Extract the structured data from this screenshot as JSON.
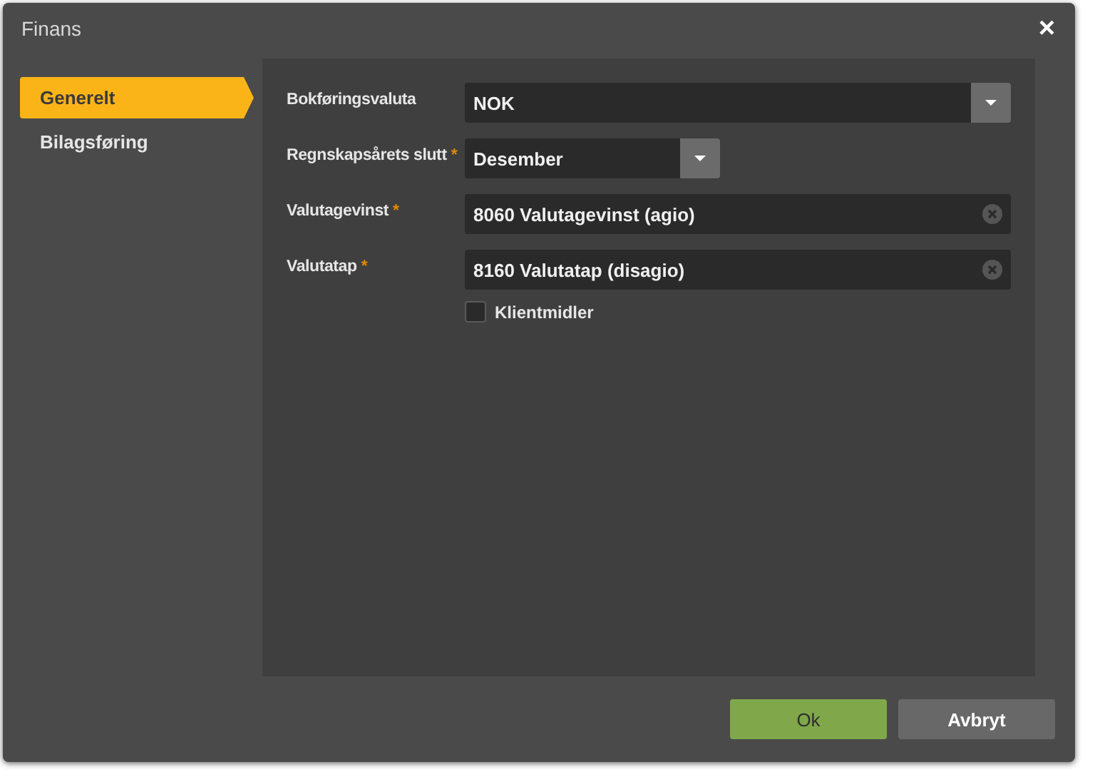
{
  "window": {
    "title": "Finans",
    "close": "×"
  },
  "sidebar": {
    "items": [
      {
        "label": "Generelt",
        "selected": true
      },
      {
        "label": "Bilagsføring",
        "selected": false
      }
    ]
  },
  "fields": [
    {
      "kind": "select",
      "label": "Bokføringsvaluta",
      "value": "NOK"
    },
    {
      "kind": "short-select",
      "label": "Regnskapsårets slutt",
      "required_mark": "*",
      "value": "Desember"
    },
    {
      "kind": "lookup",
      "label": "Valutagevinst",
      "required_mark": "*",
      "value": "8060 Valutagevinst (agio)"
    },
    {
      "kind": "lookup",
      "label": "Valutatap",
      "required_mark": "*",
      "value": "8160 Valutatap (disagio)"
    }
  ],
  "checkbox": {
    "label": "Klientmidler",
    "checked": false
  },
  "buttons": [
    {
      "kind": "primary",
      "label": "Ok"
    },
    {
      "kind": "secondary",
      "label": "Avbryt"
    }
  ]
}
